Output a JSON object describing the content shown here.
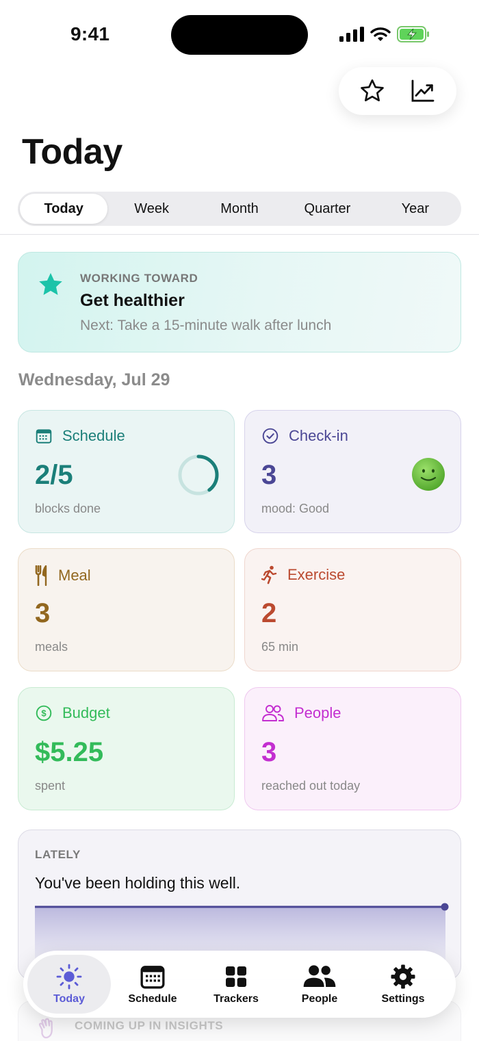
{
  "status_bar": {
    "time": "9:41"
  },
  "top_actions": [
    {
      "icon": "star-icon"
    },
    {
      "icon": "trend-chart-icon"
    }
  ],
  "page_title": "Today",
  "range_tabs": [
    {
      "label": "Today",
      "active": true
    },
    {
      "label": "Week",
      "active": false
    },
    {
      "label": "Month",
      "active": false
    },
    {
      "label": "Quarter",
      "active": false
    },
    {
      "label": "Year",
      "active": false
    }
  ],
  "goal": {
    "eyebrow": "WORKING TOWARD",
    "title": "Get healthier",
    "next": "Next: Take a 15-minute walk after lunch",
    "icon": "star-icon",
    "accent": "#1cc3a9"
  },
  "date_heading": "Wednesday, Jul 29",
  "tiles": {
    "schedule": {
      "label": "Schedule",
      "value": "2/5",
      "sub": "blocks done",
      "progress": 0.4,
      "color": "#1b7f79"
    },
    "checkin": {
      "label": "Check-in",
      "value": "3",
      "sub": "mood: Good",
      "color": "#4b4795"
    },
    "meal": {
      "label": "Meal",
      "value": "3",
      "sub": "meals",
      "color": "#92671f"
    },
    "exercise": {
      "label": "Exercise",
      "value": "2",
      "sub": "65 min",
      "color": "#bb4a30"
    },
    "budget": {
      "label": "Budget",
      "value": "$5.25",
      "sub": "spent",
      "color": "#33bb5a"
    },
    "people": {
      "label": "People",
      "value": "3",
      "sub": "reached out today",
      "color": "#c32ed0"
    }
  },
  "lately": {
    "eyebrow": "LATELY",
    "text": "You've been holding this well.",
    "line_color": "#4b4795"
  },
  "coming_up": {
    "eyebrow": "COMING UP IN INSIGHTS",
    "icon": "wave-hand-icon"
  },
  "tab_bar": [
    {
      "label": "Today",
      "icon": "sun-icon",
      "active": true
    },
    {
      "label": "Schedule",
      "icon": "calendar-icon",
      "active": false
    },
    {
      "label": "Trackers",
      "icon": "grid-icon",
      "active": false
    },
    {
      "label": "People",
      "icon": "people-icon",
      "active": false
    },
    {
      "label": "Settings",
      "icon": "gear-icon",
      "active": false
    }
  ],
  "colors": {
    "accent": "#5b5bd6"
  }
}
